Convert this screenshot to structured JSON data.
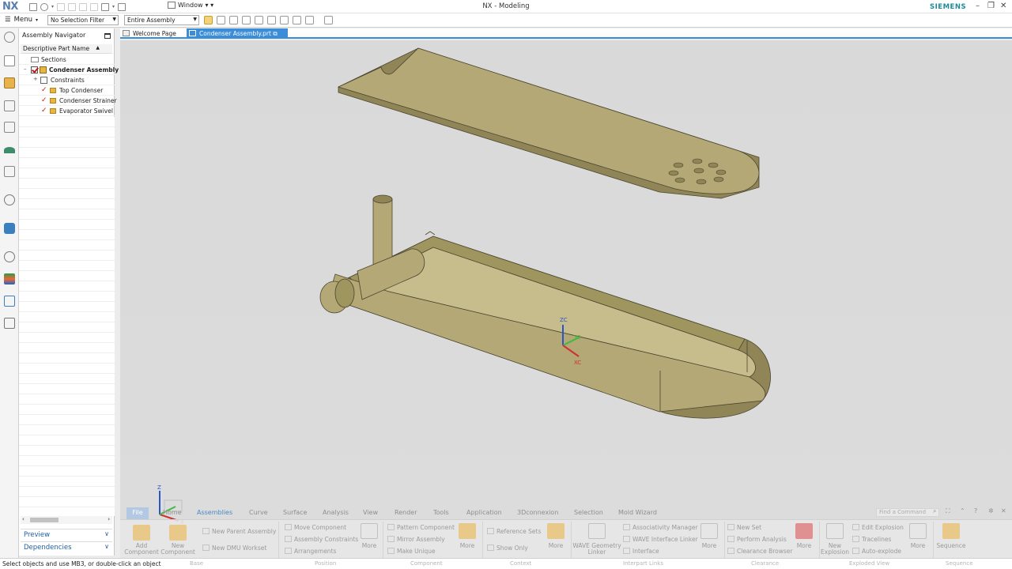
{
  "app": {
    "logo": "NX",
    "title": "NX - Modeling",
    "brand": "SIEMENS",
    "window_menu": "Window"
  },
  "toolbar": {
    "menu_label": "Menu",
    "selection_filter": "No Selection Filter",
    "scope": "Entire Assembly"
  },
  "navigator": {
    "title": "Assembly Navigator",
    "column_header": "Descriptive Part Name",
    "rows": [
      {
        "label": "Sections"
      },
      {
        "label": "Condenser Assembly ("
      },
      {
        "label": "Constraints"
      },
      {
        "label": "Top Condenser"
      },
      {
        "label": "Condenser Strainer"
      },
      {
        "label": "Evaporator Swivel"
      }
    ],
    "preview_label": "Preview",
    "dependencies_label": "Dependencies"
  },
  "tabs": [
    {
      "label": "Welcome Page"
    },
    {
      "label": "Condenser Assembly.prt"
    }
  ],
  "viewport": {
    "triad_labels": {
      "z": "ZC",
      "y": "YC",
      "x": "XC"
    },
    "csys_labels": {
      "z": "Z",
      "x": "X"
    },
    "colors": {
      "part": "#b3a876",
      "part_dark": "#8f8556",
      "part_light": "#c7bd8c",
      "edge": "#4b4530",
      "background": "#dadada"
    }
  },
  "ribbon_tabs": [
    "File",
    "Home",
    "Assemblies",
    "Curve",
    "Surface",
    "Analysis",
    "View",
    "Render",
    "Tools",
    "Application",
    "3Dconnexion",
    "Selection",
    "Mold Wizard"
  ],
  "find_command_placeholder": "Find a Command",
  "ribbon": {
    "base": {
      "add_component": "Add Component",
      "new_component": "New Component",
      "new_parent": "New Parent Assembly",
      "new_dmu": "New DMU Workset"
    },
    "position": {
      "move": "Move Component",
      "constraints": "Assembly Constraints",
      "arrangements": "Arrangements",
      "more": "More"
    },
    "component": {
      "pattern": "Pattern Component",
      "mirror": "Mirror Assembly",
      "unique": "Make Unique",
      "more": "More"
    },
    "context": {
      "reference_sets": "Reference Sets",
      "show_only": "Show Only",
      "more": "More"
    },
    "interpart": {
      "wave_geometry": "WAVE Geometry Linker",
      "assoc_manager": "Associativity Manager",
      "wave_interface": "WAVE Interface Linker",
      "interface": "Interface",
      "more": "More"
    },
    "clearance": {
      "new_set": "New Set",
      "perform": "Perform Analysis",
      "browser": "Clearance Browser",
      "more": "More"
    },
    "exploded": {
      "new_explosion": "New Explosion",
      "edit": "Edit Explosion",
      "tracelines": "Tracelines",
      "auto": "Auto-explode",
      "more": "More"
    },
    "sequence": {
      "label": "Sequence"
    },
    "group_labels": [
      "Base",
      "Position",
      "Component",
      "Context",
      "Interpart Links",
      "Clearance",
      "Exploded View",
      "Sequence"
    ]
  },
  "status": "Select objects and use MB3, or double-click an object"
}
